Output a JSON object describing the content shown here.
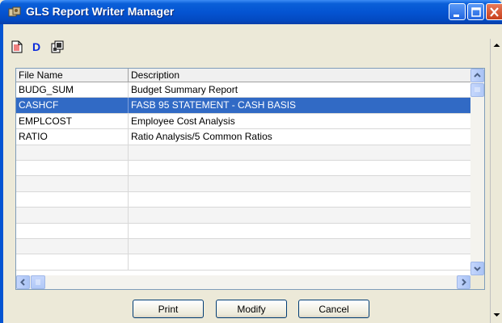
{
  "window": {
    "title": "GLS Report Writer Manager"
  },
  "toolbar": {
    "items": [
      {
        "name": "new-report",
        "icon": "document-icon"
      },
      {
        "name": "d",
        "label": "D",
        "icon": "letter-d-icon"
      },
      {
        "name": "copy",
        "icon": "copy-icon"
      }
    ]
  },
  "grid": {
    "columns": [
      "File Name",
      "Description"
    ],
    "rows": [
      {
        "file": "BUDG_SUM",
        "desc": "Budget Summary Report",
        "selected": false
      },
      {
        "file": "CASHCF",
        "desc": "FASB 95 STATEMENT - CASH BASIS",
        "selected": true
      },
      {
        "file": "EMPLCOST",
        "desc": "Employee Cost Analysis",
        "selected": false
      },
      {
        "file": "RATIO",
        "desc": "Ratio Analysis/5 Common Ratios",
        "selected": false
      }
    ],
    "empty_rows": 9
  },
  "buttons": {
    "print": "Print",
    "modify": "Modify",
    "cancel": "Cancel"
  },
  "colors": {
    "titlebar": "#0454d2",
    "selection": "#316ac5",
    "window_bg": "#ece9d8"
  }
}
